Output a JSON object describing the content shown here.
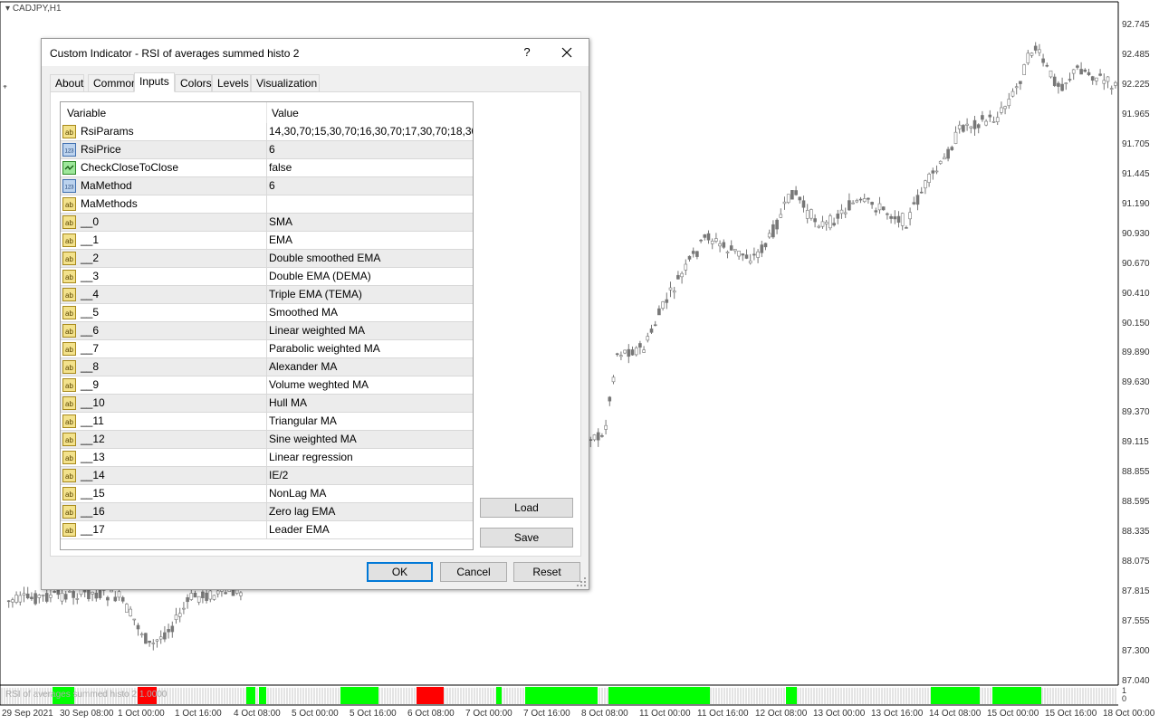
{
  "chart": {
    "symbol": "CADJPY,H1",
    "price_labels": [
      "92.745",
      "92.485",
      "92.225",
      "91.965",
      "91.705",
      "91.445",
      "91.190",
      "90.930",
      "90.670",
      "90.410",
      "90.150",
      "89.890",
      "89.630",
      "89.370",
      "89.115",
      "88.855",
      "88.595",
      "88.335",
      "88.075",
      "87.815",
      "87.555",
      "87.300",
      "87.040"
    ],
    "time_labels": [
      "29 Sep 2021",
      "30 Sep 08:00",
      "1 Oct 00:00",
      "1 Oct 16:00",
      "4 Oct 08:00",
      "5 Oct 00:00",
      "5 Oct 16:00",
      "6 Oct 08:00",
      "7 Oct 00:00",
      "7 Oct 16:00",
      "8 Oct 08:00",
      "11 Oct 00:00",
      "11 Oct 16:00",
      "12 Oct 08:00",
      "13 Oct 00:00",
      "13 Oct 16:00",
      "14 Oct 08:00",
      "15 Oct 00:00",
      "15 Oct 16:00",
      "18 Oct 00:00"
    ],
    "indicator_label": "RSI of averages summed histo 2 1.0000",
    "indicator_scale": [
      "1",
      "0"
    ],
    "colors": {
      "candle": "#777777",
      "histo_up": "#00ff00",
      "histo_down": "#ff0000"
    }
  },
  "dialog": {
    "title": "Custom Indicator - RSI of averages summed histo 2",
    "help_label": "?",
    "tabs": [
      "About",
      "Common",
      "Inputs",
      "Colors",
      "Levels",
      "Visualization"
    ],
    "active_tab": "Inputs",
    "columns": [
      "Variable",
      "Value"
    ],
    "rows": [
      {
        "type": "ab",
        "variable": "RsiParams",
        "value": "14,30,70;15,30,70;16,30,70;17,30,70;18,30,..."
      },
      {
        "type": "123",
        "variable": "RsiPrice",
        "value": "6"
      },
      {
        "type": "bool",
        "variable": "CheckCloseToClose",
        "value": "false"
      },
      {
        "type": "123",
        "variable": "MaMethod",
        "value": "6"
      },
      {
        "type": "ab",
        "variable": "MaMethods",
        "value": ""
      },
      {
        "type": "ab",
        "variable": "__0",
        "value": "SMA"
      },
      {
        "type": "ab",
        "variable": "__1",
        "value": "EMA"
      },
      {
        "type": "ab",
        "variable": "__2",
        "value": "Double smoothed EMA"
      },
      {
        "type": "ab",
        "variable": "__3",
        "value": "Double EMA (DEMA)"
      },
      {
        "type": "ab",
        "variable": "__4",
        "value": "Triple EMA (TEMA)"
      },
      {
        "type": "ab",
        "variable": "__5",
        "value": "Smoothed MA"
      },
      {
        "type": "ab",
        "variable": "__6",
        "value": "Linear weighted MA"
      },
      {
        "type": "ab",
        "variable": "__7",
        "value": "Parabolic weighted MA"
      },
      {
        "type": "ab",
        "variable": "__8",
        "value": "Alexander MA"
      },
      {
        "type": "ab",
        "variable": "__9",
        "value": "Volume weghted MA"
      },
      {
        "type": "ab",
        "variable": "__10",
        "value": "Hull MA"
      },
      {
        "type": "ab",
        "variable": "__11",
        "value": "Triangular MA"
      },
      {
        "type": "ab",
        "variable": "__12",
        "value": "Sine weighted MA"
      },
      {
        "type": "ab",
        "variable": "__13",
        "value": "Linear regression"
      },
      {
        "type": "ab",
        "variable": "__14",
        "value": "IE/2"
      },
      {
        "type": "ab",
        "variable": "__15",
        "value": "NonLag MA"
      },
      {
        "type": "ab",
        "variable": "__16",
        "value": "Zero lag EMA"
      },
      {
        "type": "ab",
        "variable": "__17",
        "value": "Leader EMA"
      }
    ],
    "icon_labels": {
      "ab": "ab",
      "123": "123"
    },
    "buttons": {
      "load": "Load",
      "save": "Save",
      "ok": "OK",
      "cancel": "Cancel",
      "reset": "Reset"
    }
  }
}
